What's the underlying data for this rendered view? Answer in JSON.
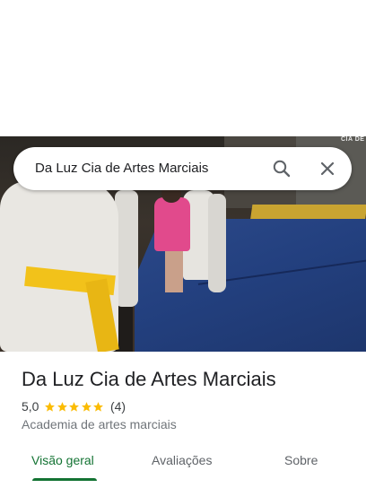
{
  "search": {
    "query": "Da Luz Cia de Artes Marciais",
    "icons": [
      "search-icon",
      "close-icon"
    ]
  },
  "photo": {
    "sign_text": "CIA DE"
  },
  "place": {
    "name": "Da Luz Cia de Artes Marciais",
    "rating": "5,0",
    "stars": 5,
    "review_count": "(4)",
    "category": "Academia de artes marciais"
  },
  "tabs": [
    {
      "label": "Visão geral",
      "active": true
    },
    {
      "label": "Avaliações",
      "active": false
    },
    {
      "label": "Sobre",
      "active": false
    }
  ],
  "colors": {
    "accent": "#137333",
    "star": "#fbbc04",
    "text": "#202124",
    "muted": "#70757a"
  }
}
